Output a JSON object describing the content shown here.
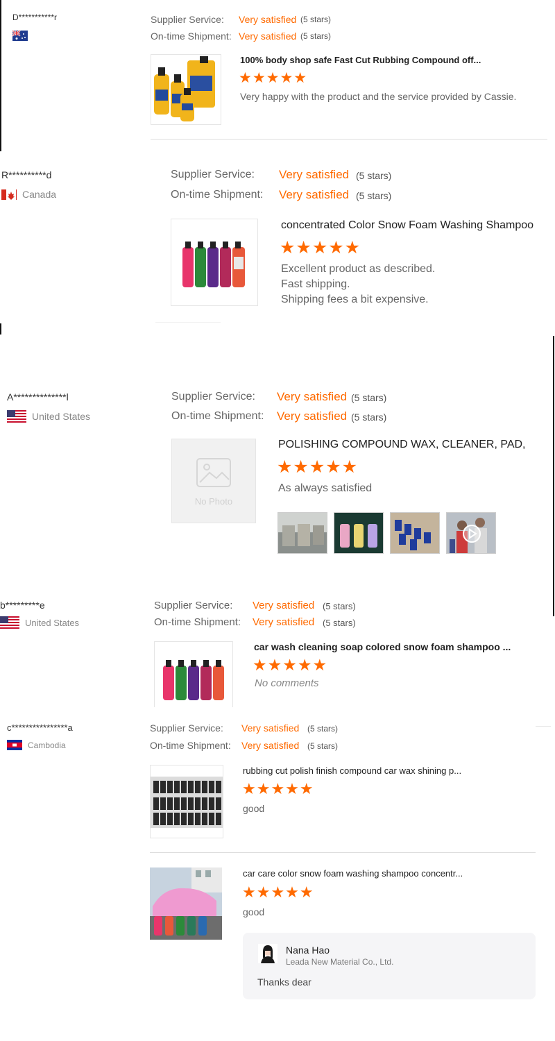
{
  "labels": {
    "supplier_service": "Supplier Service:",
    "ontime_shipment": "On-time Shipment:",
    "very_satisfied": "Very satisfied",
    "five_stars": "(5 stars)",
    "stars": "★★★★★"
  },
  "reviews": [
    {
      "user": "D***********r",
      "country": "",
      "product_title": "100% body shop safe Fast Cut Rubbing Compound off...",
      "comment": "Very happy with the product and the service provided by Cassie."
    },
    {
      "user": "R**********d",
      "country": "Canada",
      "product_title": "concentrated Color Snow Foam Washing Shampoo",
      "comment": [
        "Excellent product as described.",
        "Fast shipping.",
        "Shipping fees a bit expensive."
      ]
    },
    {
      "user": "A**************l",
      "country": "United States",
      "product_title": "POLISHING COMPOUND WAX, CLEANER, PAD,",
      "comment": "As always satisfied",
      "no_photo": "No Photo"
    },
    {
      "user": "b*********e",
      "country": "United States",
      "product_title": "car wash cleaning soap colored snow foam shampoo ...",
      "comment": "No comments"
    },
    {
      "user": "c****************a",
      "country": "Cambodia",
      "products": [
        {
          "product_title": "rubbing cut polish finish compound car wax shining p...",
          "comment": "good"
        },
        {
          "product_title": "car care color snow foam washing shampoo concentr...",
          "comment": "good"
        }
      ],
      "reply": {
        "name": "Nana Hao",
        "company": "Leada New Material Co., Ltd.",
        "text": "Thanks dear"
      }
    }
  ],
  "colors": {
    "accent": "#ff6a00",
    "text": "#333333",
    "muted": "#888888"
  }
}
